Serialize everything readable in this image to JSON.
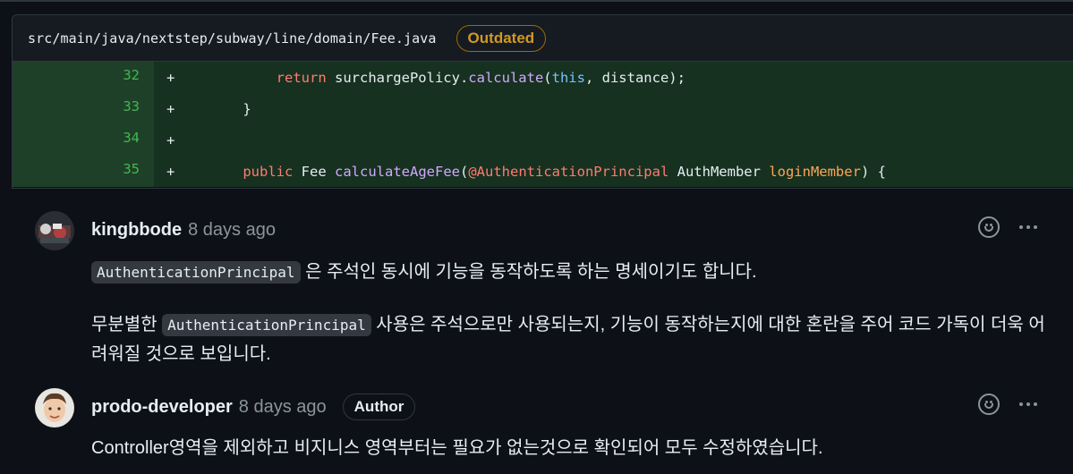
{
  "file": {
    "path": "src/main/java/nextstep/subway/line/domain/Fee.java",
    "badge": "Outdated"
  },
  "diff": {
    "rows": [
      {
        "line": "32",
        "sign": "+",
        "code": "        return surchargePolicy.calculate(this, distance);"
      },
      {
        "line": "33",
        "sign": "+",
        "code": "    }"
      },
      {
        "line": "34",
        "sign": "+",
        "code": ""
      },
      {
        "line": "35",
        "sign": "+",
        "code": "    public Fee calculateAgeFee(@AuthenticationPrincipal AuthMember loginMember) {"
      }
    ]
  },
  "comments": [
    {
      "author": "kingbbode",
      "time": "8 days ago",
      "badge": "",
      "p1_code": "AuthenticationPrincipal",
      "p1_text": " 은 주석인 동시에 기능을 동작하도록 하는 명세이기도 합니다.",
      "p2_pre": "무분별한 ",
      "p2_code": "AuthenticationPrincipal",
      "p2_post": " 사용은 주석으로만 사용되는지, 기능이 동작하는지에 대한 혼란을 주어 코드 가독이 더욱 어려워질 것으로 보입니다."
    },
    {
      "author": "prodo-developer",
      "time": "8 days ago",
      "badge": "Author",
      "text": "Controller영역을 제외하고 비지니스 영역부터는 필요가 없는것으로 확인되어 모두 수정하였습니다."
    }
  ],
  "icons": {
    "reaction": "smiley-icon",
    "more": "kebab-horizontal-icon"
  },
  "colors": {
    "background": "#0d1117",
    "added_line": "#16311f",
    "added_gutter": "#1f4028",
    "outdated": "#d29922"
  }
}
